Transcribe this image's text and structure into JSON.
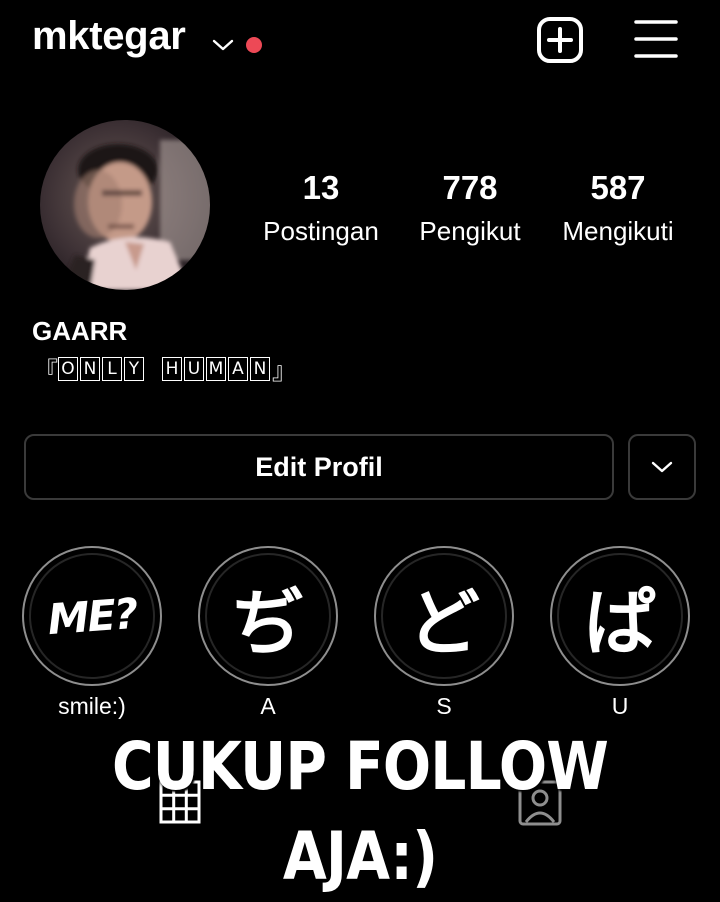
{
  "header": {
    "username": "mktegar",
    "icons": [
      "chevron-down-icon",
      "notification-dot",
      "add-post-icon",
      "hamburger-menu-icon"
    ],
    "dot_color": "#ed4956"
  },
  "profile": {
    "avatar_icon": "profile-photo",
    "stats": [
      {
        "value": "13",
        "label": "Postingan"
      },
      {
        "value": "778",
        "label": "Pengikut"
      },
      {
        "value": "587",
        "label": "Mengikuti"
      }
    ],
    "display_name": "GAARR",
    "bio": {
      "open_bracket": "『",
      "word1": [
        "O",
        "N",
        "L",
        "Y"
      ],
      "word2": [
        "H",
        "U",
        "M",
        "A",
        "N"
      ],
      "close_bracket": "』"
    }
  },
  "actions": {
    "edit_label": "Edit Profil",
    "more_icon": "chevron-down-icon"
  },
  "highlights": [
    {
      "cover": "ME?",
      "label": "smile:)"
    },
    {
      "cover": "ぢ",
      "label": "A"
    },
    {
      "cover": "ど",
      "label": "S"
    },
    {
      "cover": "ぱ",
      "label": "U"
    }
  ],
  "bottom_tabs": [
    "grid-icon",
    "tagged-icon"
  ],
  "overlay_caption": "CUKUP FOLLOW AJA:)"
}
